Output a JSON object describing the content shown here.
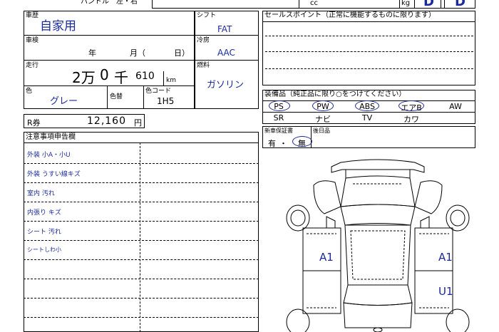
{
  "top_strip": {
    "handle_label": "ハンドル　左・右",
    "cc_unit": "cc",
    "kg_unit": "kg",
    "grade_left": "D",
    "grade_right": "D"
  },
  "history": {
    "label": "車歴",
    "value": "自家用"
  },
  "inspection": {
    "label": "車検",
    "year_unit": "年",
    "month_unit": "月（",
    "day_unit": "日）"
  },
  "mileage": {
    "label": "走行",
    "man": "2万",
    "zero": "0",
    "sen": "千",
    "hundreds": "610",
    "unit": "km"
  },
  "color": {
    "label": "色",
    "value": "グレー",
    "change_label": "色替",
    "code_label": "色コード",
    "code_value": "1H5"
  },
  "recycle": {
    "label": "R券",
    "value": "12,160",
    "unit": "円"
  },
  "shift": {
    "label": "シフト",
    "value": "FAT"
  },
  "aircon": {
    "label": "冷房",
    "value": "AAC"
  },
  "fuel": {
    "label": "燃料",
    "value": "ガソリン"
  },
  "sales_points": {
    "label": "セールスポイント（正常に機能するものに限ります）"
  },
  "equipment": {
    "label": "装備品（純正品に限り○をつけてください）",
    "row1": [
      "PS",
      "PW",
      "ABS",
      "エアB",
      "AW"
    ],
    "row2": [
      "SR",
      "ナビ",
      "TV",
      "カワ",
      ""
    ]
  },
  "warranty": {
    "label": "新車保証書",
    "yes": "有",
    "dot": "・",
    "no": "無"
  },
  "delivery": {
    "label": "後日品"
  },
  "notes": {
    "label": "注意事項申告欄",
    "items": [
      "外装 小A・小U",
      "外装 うすい線キズ",
      "室内 汚れ",
      "内張り キズ",
      "シート 汚れ",
      "シートしわ小"
    ]
  },
  "diagram": {
    "left_mark": "A1",
    "right_mark": "A1",
    "right_lower_mark": "U1"
  }
}
